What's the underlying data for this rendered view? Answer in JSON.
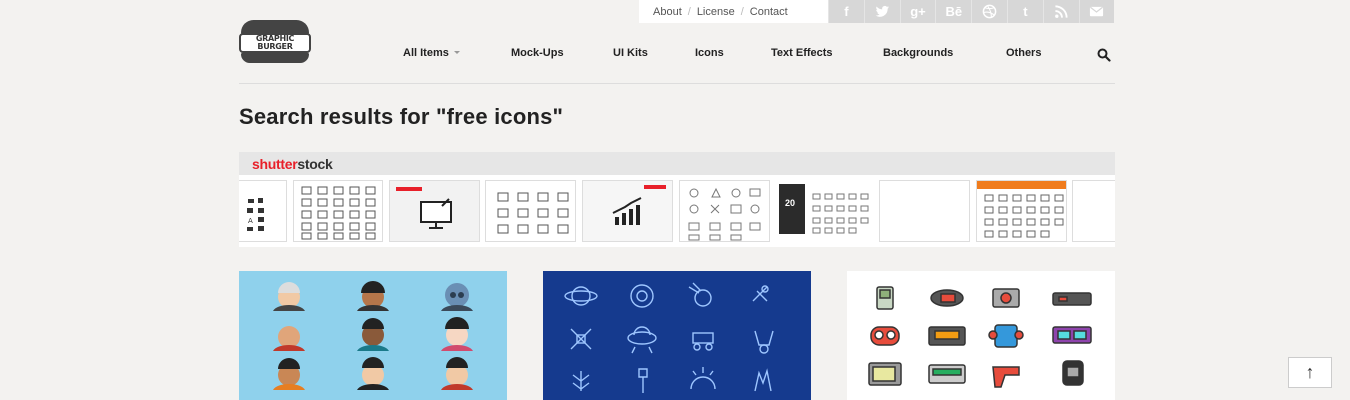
{
  "site": {
    "logo_line1": "GRAPHIC",
    "logo_line2": "BURGER"
  },
  "top_links": [
    "About",
    "License",
    "Contact"
  ],
  "social": [
    {
      "name": "facebook-icon",
      "glyph": "f"
    },
    {
      "name": "twitter-icon",
      "glyph": ""
    },
    {
      "name": "google-plus-icon",
      "glyph": "g+"
    },
    {
      "name": "behance-icon",
      "glyph": "Bē"
    },
    {
      "name": "dribbble-icon",
      "glyph": ""
    },
    {
      "name": "tumblr-icon",
      "glyph": "t"
    },
    {
      "name": "rss-icon",
      "glyph": ""
    },
    {
      "name": "mail-icon",
      "glyph": ""
    }
  ],
  "nav": [
    "All Items",
    "Mock-Ups",
    "UI Kits",
    "Icons",
    "Text Effects",
    "Backgrounds",
    "Others"
  ],
  "page_title": "Search results for \"free icons\"",
  "shutterstock": {
    "brand_red": "shutter",
    "brand_dark": "stock"
  },
  "thumb_labels": {
    "dark_thumb_number": "20"
  },
  "scroll_top": "↑",
  "colors": {
    "card1_bg": "#8fd1ec",
    "card2_bg": "#153a8e",
    "card3_bg": "#ffffff",
    "shutterstock_red": "#e8202a"
  }
}
